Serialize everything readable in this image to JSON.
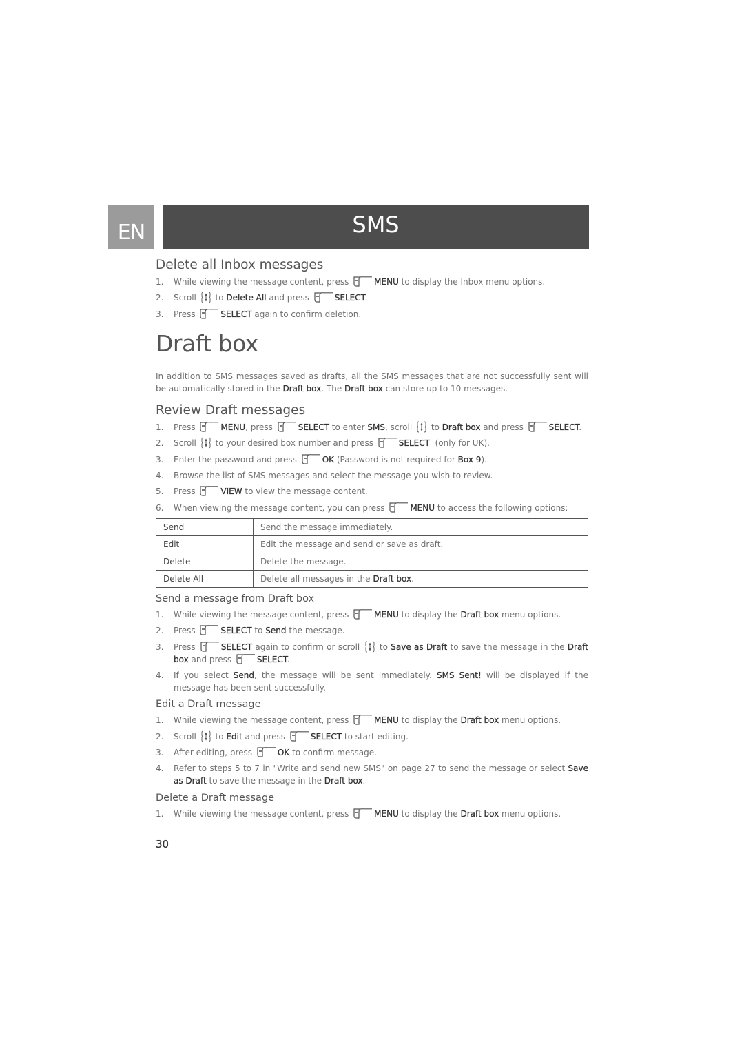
{
  "header": {
    "language": "EN",
    "chapter_title": "SMS"
  },
  "icons": {
    "softkey": "left-softkey-icon",
    "scroll": "scroll-key-icon"
  },
  "delete_all_inbox": {
    "title": "Delete all Inbox messages",
    "steps": [
      {
        "num": "1.",
        "parts": [
          "While viewing the message content, press ",
          "MENU",
          " to display the Inbox menu options."
        ]
      },
      {
        "num": "2.",
        "parts": [
          "Scroll ",
          "to ",
          "Delete All",
          " and press ",
          "SELECT",
          "."
        ]
      },
      {
        "num": "3.",
        "parts": [
          "Press ",
          "SELECT",
          " again to confirm deletion."
        ]
      }
    ]
  },
  "draft_box": {
    "title": "Draft box",
    "intro": [
      "In addition to SMS messages saved as drafts, all the SMS messages that are not successfully sent will be automatically stored in the ",
      "Draft box",
      ". The ",
      "Draft box",
      " can store up to 10 messages."
    ]
  },
  "review_draft": {
    "title": "Review Draft messages",
    "steps": [
      {
        "num": "1.",
        "parts": [
          "Press ",
          "MENU",
          ", press ",
          "SELECT",
          " to enter ",
          "SMS",
          ", scroll ",
          " to ",
          "Draft box",
          " and press ",
          "SELECT",
          "."
        ]
      },
      {
        "num": "2.",
        "parts": [
          "Scroll ",
          " to your desired box number and press ",
          "SELECT",
          "  (only for UK)."
        ]
      },
      {
        "num": "3.",
        "parts": [
          "Enter the password and press ",
          "OK",
          " (Password is not required for ",
          "Box 9",
          ")."
        ]
      },
      {
        "num": "4.",
        "parts": [
          "Browse the list of SMS messages and select the message you wish to review."
        ]
      },
      {
        "num": "5.",
        "parts": [
          "Press ",
          "VIEW",
          " to view the message content."
        ]
      },
      {
        "num": "6.",
        "parts": [
          "When viewing the message content, you can press ",
          "MENU",
          " to access the following options:"
        ]
      }
    ],
    "options_table": [
      {
        "option": "Send",
        "description": "Send the message immediately."
      },
      {
        "option": "Edit",
        "description": "Edit the message and send or save as draft."
      },
      {
        "option": "Delete",
        "description": "Delete the message."
      },
      {
        "option": "Delete All",
        "description_parts": [
          "Delete all messages in the ",
          "Draft box",
          "."
        ]
      }
    ]
  },
  "send_from_draft": {
    "title": "Send a message from Draft box",
    "steps": [
      {
        "num": "1.",
        "parts": [
          "While viewing the message content, press ",
          "MENU",
          " to display the ",
          "Draft box",
          " menu options."
        ]
      },
      {
        "num": "2.",
        "parts": [
          "Press ",
          "SELECT",
          " to ",
          "Send",
          " the message."
        ]
      },
      {
        "num": "3.",
        "parts": [
          "Press ",
          "SELECT",
          " again to confirm or scroll ",
          " to ",
          "Save as Draft",
          " to save the message in the ",
          "Draft box",
          " and press ",
          "SELECT",
          "."
        ]
      },
      {
        "num": "4.",
        "parts": [
          "If you select ",
          "Send",
          ", the message will be sent immediately. ",
          "SMS Sent!",
          " will be displayed if the message has been sent successfully."
        ]
      }
    ]
  },
  "edit_draft": {
    "title": "Edit a Draft message",
    "steps": [
      {
        "num": "1.",
        "parts": [
          "While viewing the message content, press ",
          "MENU",
          " to display the ",
          "Draft box",
          " menu options."
        ]
      },
      {
        "num": "2.",
        "parts": [
          "Scroll ",
          " to ",
          "Edit",
          " and press ",
          "SELECT",
          " to start editing."
        ]
      },
      {
        "num": "3.",
        "parts": [
          "After editing, press ",
          "OK",
          " to confirm message."
        ]
      },
      {
        "num": "4.",
        "parts": [
          "Refer to steps 5 to 7 in \"Write and send new SMS\" on page 27 to send the message or select ",
          "Save as Draft",
          " to save the message in the ",
          "Draft box",
          "."
        ]
      }
    ]
  },
  "delete_draft": {
    "title": "Delete a Draft message",
    "steps": [
      {
        "num": "1.",
        "parts": [
          "While viewing the message content, press ",
          "MENU",
          " to display the ",
          "Draft box",
          " menu options."
        ]
      }
    ]
  },
  "footer": {
    "page_number": "30"
  }
}
